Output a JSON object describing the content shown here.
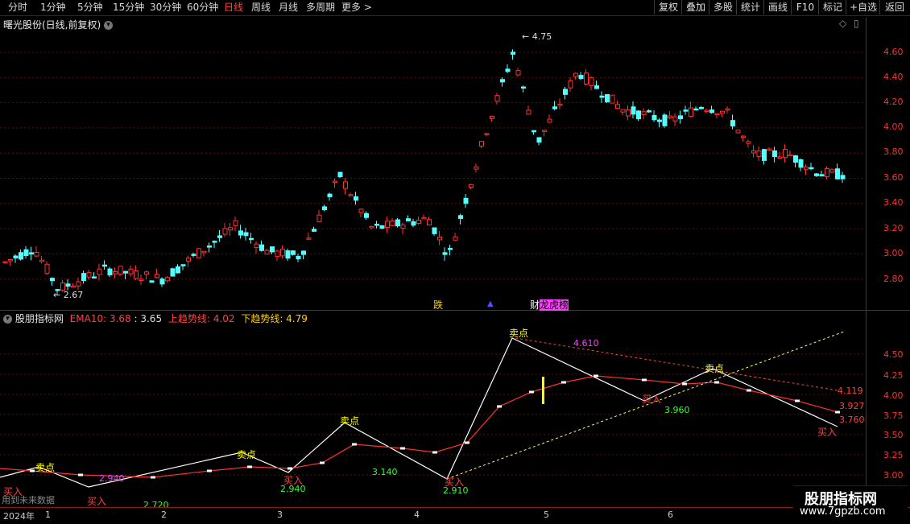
{
  "toolbar": {
    "periods": [
      "分时",
      "1分钟",
      "5分钟",
      "15分钟",
      "30分钟",
      "60分钟",
      "日线",
      "周线",
      "月线",
      "多周期",
      "更多"
    ],
    "active_period": "日线",
    "buttons": [
      "复权",
      "叠加",
      "多股",
      "统计",
      "画线",
      "F10",
      "+自选",
      "返回"
    ],
    "extra_button": "标记"
  },
  "main_chart": {
    "title": "曙光股份(日线,前复权)",
    "y_ticks": [
      "4.60",
      "4.40",
      "4.20",
      "4.00",
      "3.80",
      "3.60",
      "3.40",
      "3.20",
      "3.00",
      "2.80"
    ],
    "high_label": "4.75",
    "low_label": "2.67",
    "markers": {
      "fall": "跌",
      "list": "龙虎榜",
      "list_prefix": "财"
    },
    "colors": {
      "up": "#ff3030",
      "down": "#54ffff",
      "grid": "#5a1010",
      "axis": "#ff3030"
    }
  },
  "indicator": {
    "name": "股朋指标网",
    "ema_label": "EMA10: 3.68",
    "value_label": ": 3.65",
    "up_trend_label": "上趋势线: 4.02",
    "down_trend_label": "下趋势线: 4.79",
    "y_ticks": [
      "4.50",
      "4.25",
      "4.00",
      "3.75",
      "3.50",
      "3.25",
      "3.00"
    ],
    "sell_label": "卖点",
    "buy_label": "买入",
    "value_labels": [
      "2.940",
      "2.720",
      "2.940",
      "3.140",
      "2.910",
      "3.960",
      "4.610",
      "3.927",
      "3.760",
      "4.119"
    ],
    "future_note": "用到未来数据"
  },
  "date_axis": {
    "year": "2024年",
    "months": [
      "1",
      "2",
      "3",
      "4",
      "5",
      "6"
    ]
  },
  "watermark": {
    "title": "股朋指标网",
    "url": "www.7gpzb.com"
  }
}
